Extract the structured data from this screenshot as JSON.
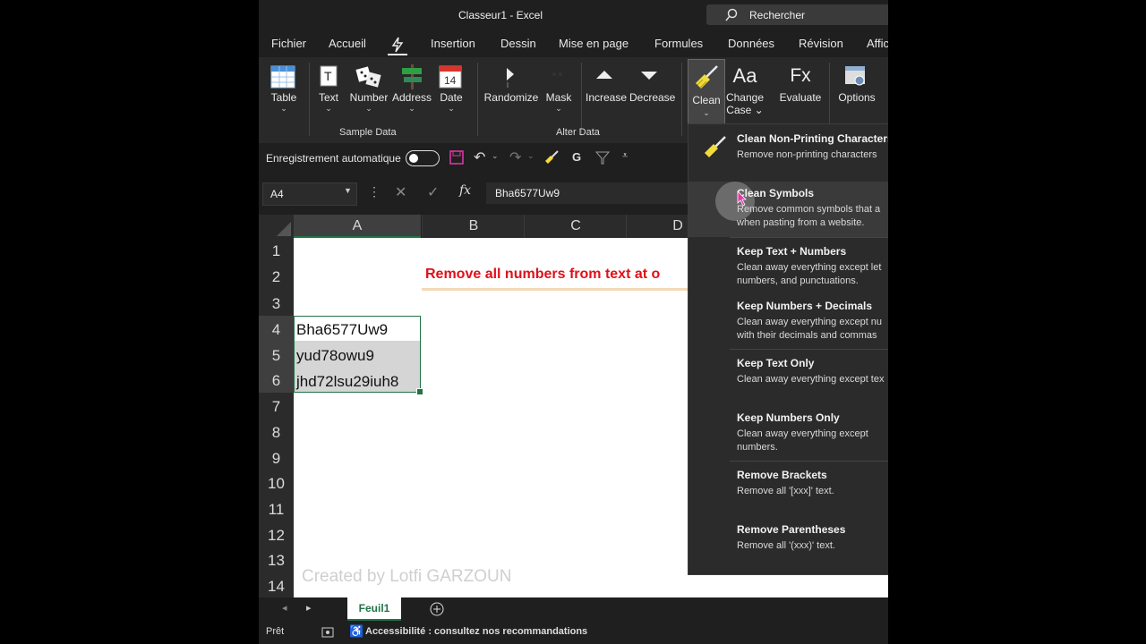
{
  "window": {
    "title": "Classeur1  -  Excel",
    "search_placeholder": "Rechercher"
  },
  "menu_tabs": [
    "Fichier",
    "Accueil",
    "Insertion",
    "Dessin",
    "Mise en page",
    "Formules",
    "Données",
    "Révision",
    "Affic"
  ],
  "ribbon": {
    "sample_data": {
      "group": "Sample Data",
      "buttons": [
        "Table",
        "Text",
        "Number",
        "Address",
        "Date"
      ],
      "date_icon_number": "14"
    },
    "alter_data": {
      "group": "Alter Data",
      "buttons": [
        "Randomize",
        "Mask",
        "Increase",
        "Decrease"
      ]
    },
    "clean": {
      "label": "Clean",
      "change_case_line1": "Change",
      "change_case_line2": "Case",
      "change_case_icon": "Aa",
      "evaluate": "Evaluate",
      "evaluate_icon": "Fx",
      "options": "Options"
    }
  },
  "qat": {
    "autosave": "Enregistrement automatique"
  },
  "formula_bar": {
    "cell_ref": "A4",
    "value": "Bha6577Uw9"
  },
  "columns": [
    "A",
    "B",
    "C",
    "D"
  ],
  "rows": [
    "1",
    "2",
    "3",
    "4",
    "5",
    "6",
    "7",
    "8",
    "9",
    "10",
    "11",
    "12",
    "13",
    "14"
  ],
  "cells": {
    "a4": "Bha6577Uw9",
    "a5": "yud78owu9",
    "a6": "jhd72lsu29iuh8"
  },
  "headline": "Remove all numbers from text at o",
  "watermark": "Created by Lotfi GARZOUN",
  "sheet_tab": "Feuil1",
  "status": {
    "ready": "Prêt",
    "accessibility": "Accessibilité : consultez nos recommandations"
  },
  "clean_menu": [
    {
      "title": "Clean Non-Printing Characters",
      "desc": [
        "Remove non-printing characters"
      ]
    },
    {
      "title": "Clean Symbols",
      "desc": [
        "Remove common symbols that a",
        "when pasting from a website."
      ]
    },
    {
      "title": "Keep Text + Numbers",
      "desc": [
        "Clean away everything except let",
        "numbers, and punctuations."
      ]
    },
    {
      "title": "Keep Numbers + Decimals",
      "desc": [
        "Clean away everything except nu",
        "with their decimals and commas"
      ]
    },
    {
      "title": "Keep Text Only",
      "desc": [
        "Clean away everything except tex"
      ]
    },
    {
      "title": "Keep Numbers Only",
      "desc": [
        "Clean away everything except",
        "numbers."
      ]
    },
    {
      "title": "Remove Brackets",
      "desc": [
        "Remove all '[xxx]' text."
      ]
    },
    {
      "title": "Remove Parentheses",
      "desc": [
        "Remove all '(xxx)' text."
      ]
    }
  ],
  "colors": {
    "excel_green": "#217346",
    "headline_red": "#e0101a",
    "clean_icon_yellow": "#f2dc3c"
  }
}
